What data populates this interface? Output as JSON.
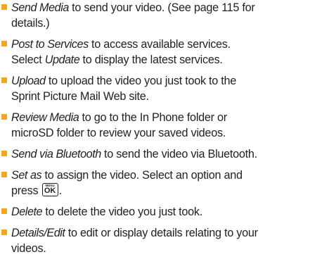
{
  "accent_color": "#f5a623",
  "bullet_icon": "square-bullet",
  "items": [
    {
      "term": "Send Media",
      "line1_rest": " to send your video. (See page 115 for",
      "line2": "details.)"
    },
    {
      "term": "Post to Services",
      "line1_rest": " to access available services.",
      "line2_prefix": "Select ",
      "line2_term": "Update",
      "line2_rest": " to display the latest services."
    },
    {
      "term": "Upload",
      "line1_rest": " to upload the video you just took to the",
      "line2": "Sprint Picture Mail Web site."
    },
    {
      "term": "Review Media",
      "line1_rest": " to go to the In Phone folder or",
      "line2": "microSD folder to review your saved videos."
    },
    {
      "term": "Send via Bluetooth",
      "line1_rest": " to send the video via Bluetooth."
    },
    {
      "term": "Set as",
      "line1_rest": " to assign the video. Select an option and",
      "line2_prefix": "press ",
      "key_top": "MENU",
      "key_main": "OK",
      "line2_rest": "."
    },
    {
      "term": "Delete",
      "line1_rest": " to delete the video you just took."
    },
    {
      "term": "Details/Edit",
      "line1_rest": " to edit or display details relating to your",
      "line2": "videos."
    }
  ]
}
